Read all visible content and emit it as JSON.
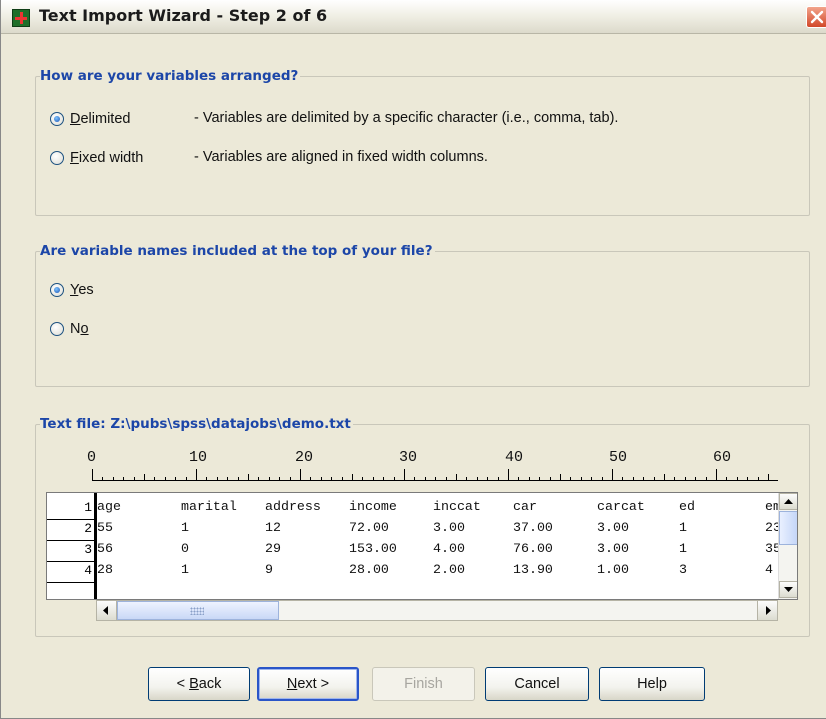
{
  "window": {
    "title": "Text Import Wizard - Step 2 of 6",
    "close_icon": "close-x-icon",
    "app_icon": "spss-grid-icon"
  },
  "arrangement": {
    "legend": "How are your variables arranged?",
    "options": [
      {
        "label_first": "D",
        "label_rest": "elimited",
        "description": "- Variables are delimited by a specific character (i.e., comma, tab).",
        "checked": true
      },
      {
        "label_first": "F",
        "label_rest": "ixed width",
        "description": "- Variables are aligned in fixed width columns.",
        "checked": false
      }
    ]
  },
  "names": {
    "legend": "Are variable names included at the top of your file?",
    "options": [
      {
        "label_first": "Y",
        "label_rest": "es",
        "checked": true
      },
      {
        "label_before": "N",
        "label_underlined": "o",
        "checked": false
      }
    ]
  },
  "preview": {
    "legend": "Text file:  Z:\\pubs\\spss\\datajobs\\demo.txt",
    "ruler_numbers": [
      "0",
      "10",
      "20",
      "30",
      "40",
      "50",
      "60"
    ],
    "row_numbers": [
      "1",
      "2",
      "3",
      "4"
    ],
    "rows": [
      [
        "age",
        "marital",
        "address",
        "income",
        "inccat",
        "car",
        "carcat",
        "ed",
        "em"
      ],
      [
        "55",
        "1",
        "12",
        "72.00",
        "3.00",
        "37.00",
        "3.00",
        "1",
        "23"
      ],
      [
        "56",
        "0",
        "29",
        "153.00",
        "4.00",
        "76.00",
        "3.00",
        "1",
        "35"
      ],
      [
        "28",
        "1",
        "9",
        "28.00",
        "2.00",
        "13.90",
        "1.00",
        "3",
        "4"
      ]
    ]
  },
  "buttons": {
    "back_prefix": "< ",
    "back_u": "B",
    "back_rest": "ack",
    "next_u": "N",
    "next_rest": "ext >",
    "finish": "Finish",
    "cancel": "Cancel",
    "help": "Help"
  },
  "colors": {
    "legend_blue": "#1c46a8",
    "title_bar_close": "#d2482a"
  }
}
